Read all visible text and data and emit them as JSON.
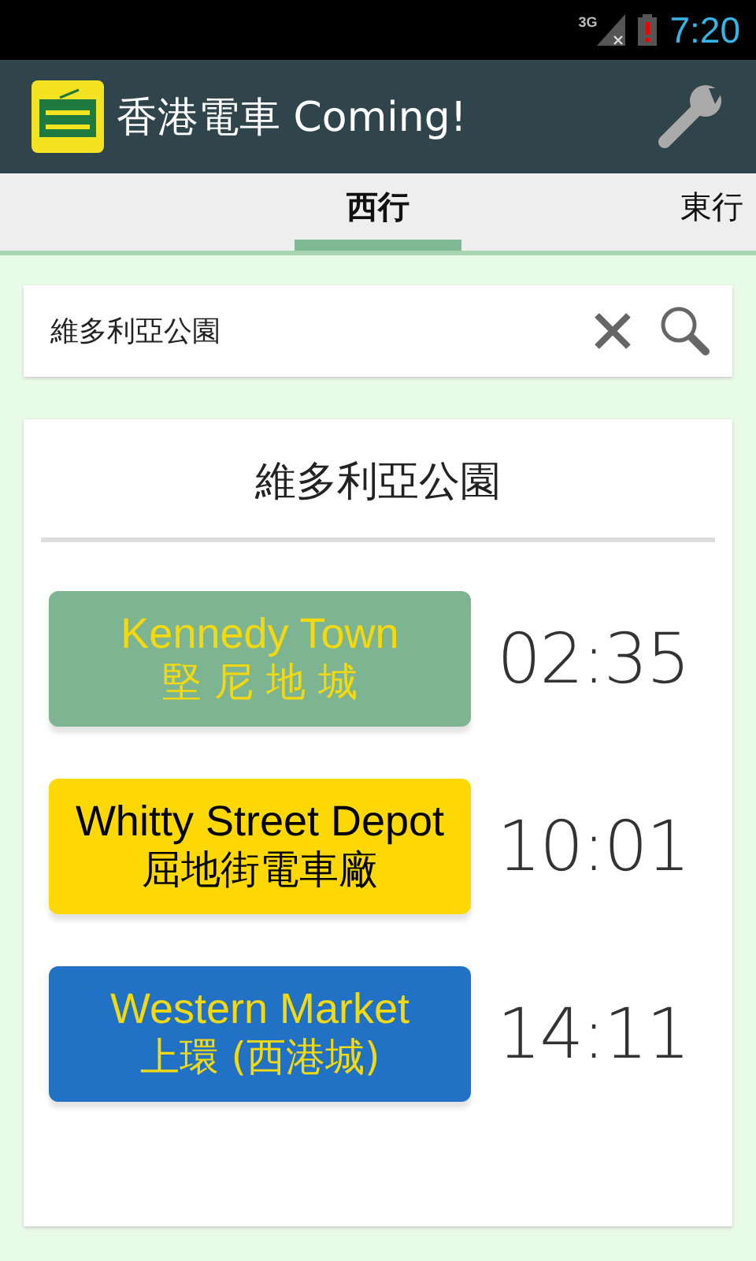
{
  "status_bar": {
    "network": "3G",
    "time": "7:20"
  },
  "app_bar": {
    "title": "香港電車 Coming!"
  },
  "tabs": [
    {
      "label": "西行",
      "selected": true
    },
    {
      "label": "東行",
      "selected": false
    }
  ],
  "search": {
    "value": "維多利亞公園"
  },
  "stop": {
    "title": "維多利亞公園",
    "arrivals": [
      {
        "destination_en": "Kennedy Town",
        "destination_zh": "堅 尼 地 城",
        "color": "#7db592",
        "dark_text": false,
        "time": "02:35"
      },
      {
        "destination_en": "Whitty Street Depot",
        "destination_zh": "屈地街電車廠",
        "color": "#fdd804",
        "dark_text": true,
        "time": "10:01"
      },
      {
        "destination_en": "Western Market",
        "destination_zh": "上環 (西港城)",
        "color": "#2172c4",
        "dark_text": false,
        "time": "14:11"
      }
    ]
  }
}
